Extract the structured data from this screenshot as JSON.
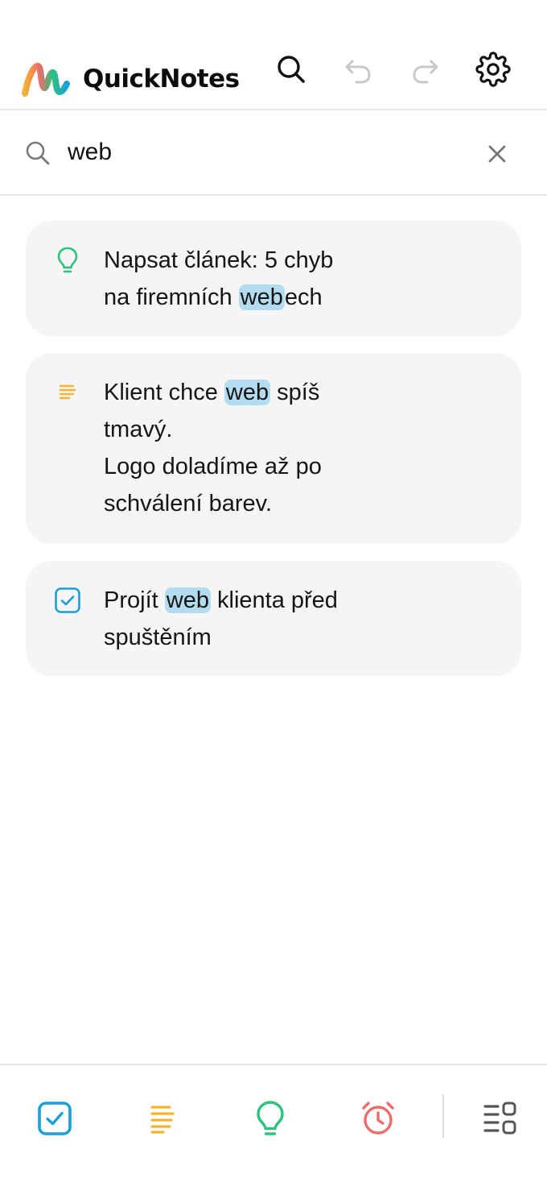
{
  "app": {
    "title": "QuickNotes"
  },
  "header": {
    "icons": [
      "search-icon",
      "undo-icon",
      "redo-icon",
      "gear-icon"
    ]
  },
  "search": {
    "value": "web",
    "placeholder": ""
  },
  "results": [
    {
      "type": "idea",
      "icon": "lightbulb-icon",
      "before": "Napsat článek: 5 chyb\nna firemních ",
      "match": "web",
      "after": "ech"
    },
    {
      "type": "note",
      "icon": "note-lines-icon",
      "before": "Klient chce ",
      "match": "web",
      "after": " spíš\ntmavý.\nLogo doladíme až po\nschválení barev."
    },
    {
      "type": "task",
      "icon": "checkbox-icon",
      "before": "Projít ",
      "match": "web",
      "after": " klienta před\nspuštěním"
    }
  ],
  "bottom_nav": {
    "items": [
      "tasks-checkbox-icon",
      "notes-lines-icon",
      "ideas-lightbulb-icon",
      "reminders-alarm-icon",
      "categories-icon"
    ]
  },
  "colors": {
    "task": "#1a9fd8",
    "note": "#f5b335",
    "idea": "#2ec27e",
    "reminder": "#ee6b6b",
    "neutral": "#555555",
    "highlight": "#b3dcf0",
    "card_bg": "#f5f5f5"
  }
}
